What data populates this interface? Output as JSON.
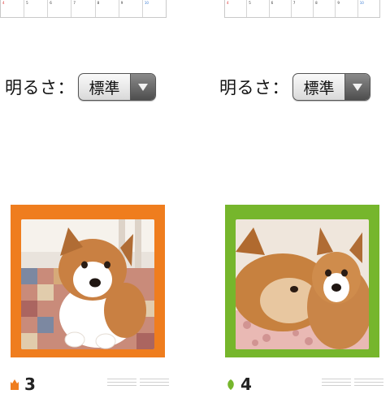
{
  "calendar_left": {
    "days": [
      {
        "num": "4",
        "type": "sun"
      },
      {
        "num": "5",
        "type": "wd"
      },
      {
        "num": "6",
        "type": "wd"
      },
      {
        "num": "7",
        "type": "wd"
      },
      {
        "num": "8",
        "type": "wd"
      },
      {
        "num": "9",
        "type": "wd"
      },
      {
        "num": "10",
        "type": "sat"
      }
    ]
  },
  "calendar_right": {
    "days": [
      {
        "num": "4",
        "type": "sun"
      },
      {
        "num": "5",
        "type": "wd"
      },
      {
        "num": "6",
        "type": "wd"
      },
      {
        "num": "7",
        "type": "wd"
      },
      {
        "num": "8",
        "type": "wd"
      },
      {
        "num": "9",
        "type": "wd"
      },
      {
        "num": "10",
        "type": "sat"
      }
    ]
  },
  "brightness_left": {
    "label": "明るさ：",
    "selected": "標準"
  },
  "brightness_right": {
    "label": "明るさ：",
    "selected": "標準"
  },
  "card_left": {
    "month": "3",
    "frame_color": "#ef7d1e",
    "icon": "cat-icon"
  },
  "card_right": {
    "month": "4",
    "frame_color": "#76b62c",
    "icon": "leaf-icon"
  }
}
